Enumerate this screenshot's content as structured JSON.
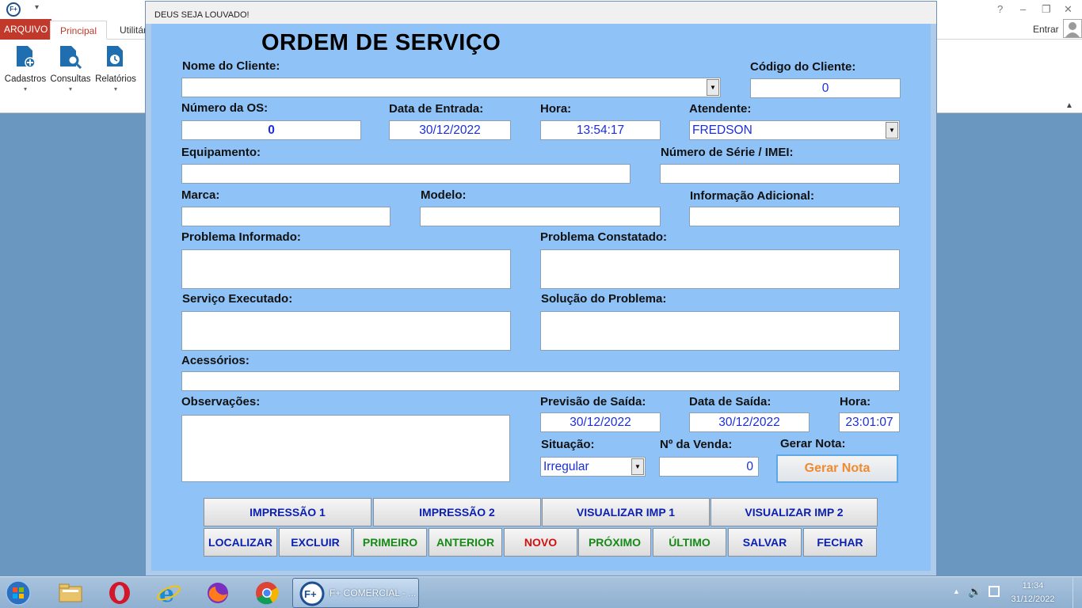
{
  "app": {
    "ribbon_tabs": [
      "ARQUIVO",
      "Principal",
      "Utilitários"
    ],
    "ribbon_buttons": [
      "Cadastros",
      "Consultas",
      "Relatórios"
    ],
    "help_icon": "?",
    "user_label": "Entrar"
  },
  "modal": {
    "window_title": "DEUS SEJA LOUVADO!",
    "form_title": "ORDEM DE SERVIÇO",
    "labels": {
      "nome_cliente": "Nome do Cliente:",
      "codigo_cliente": "Código do Cliente:",
      "numero_os": "Número da OS:",
      "data_entrada": "Data de Entrada:",
      "hora": "Hora:",
      "atendente": "Atendente:",
      "equipamento": "Equipamento:",
      "numero_serie": "Número de Série / IMEI:",
      "marca": "Marca:",
      "modelo": "Modelo:",
      "info_adicional": "Informação Adicional:",
      "problema_informado": "Problema Informado:",
      "problema_constatado": "Problema Constatado:",
      "servico_executado": "Serviço Executado:",
      "solucao_problema": "Solução do Problema:",
      "acessorios": "Acessórios:",
      "observacoes": "Observações:",
      "previsao_saida": "Previsão de Saída:",
      "data_saida": "Data de Saída:",
      "hora_saida": "Hora:",
      "situacao": "Situação:",
      "numero_venda": "Nº da Venda:",
      "gerar_nota": "Gerar Nota:"
    },
    "values": {
      "nome_cliente": "",
      "codigo_cliente": "0",
      "numero_os": "0",
      "data_entrada": "30/12/2022",
      "hora": "13:54:17",
      "atendente": "FREDSON",
      "equipamento": "",
      "numero_serie": "",
      "marca": "",
      "modelo": "",
      "info_adicional": "",
      "problema_informado": "",
      "problema_constatado": "",
      "servico_executado": "",
      "solucao_problema": "",
      "acessorios": "",
      "observacoes": "",
      "previsao_saida": "30/12/2022",
      "data_saida": "30/12/2022",
      "hora_saida": "23:01:07",
      "situacao": "Irregular",
      "numero_venda": "0"
    },
    "buttons": {
      "gerar_nota": "Gerar Nota",
      "impressao1": "IMPRESSÃO 1",
      "impressao2": "IMPRESSÃO 2",
      "visualizar1": "VISUALIZAR IMP 1",
      "visualizar2": "VISUALIZAR IMP 2",
      "localizar": "LOCALIZAR",
      "excluir": "EXCLUIR",
      "primeiro": "PRIMEIRO",
      "anterior": "ANTERIOR",
      "novo": "NOVO",
      "proximo": "PRÓXIMO",
      "ultimo": "ÚLTIMO",
      "salvar": "SALVAR",
      "fechar": "FECHAR"
    }
  },
  "taskbar": {
    "active_task": "F+ COMERCIAL - ...",
    "clock_time": "11:34",
    "clock_date": "31/12/2022",
    "pinned_icons": [
      "windows-start-icon",
      "file-explorer-icon",
      "opera-icon",
      "internet-explorer-icon",
      "firefox-icon",
      "chrome-icon"
    ]
  }
}
